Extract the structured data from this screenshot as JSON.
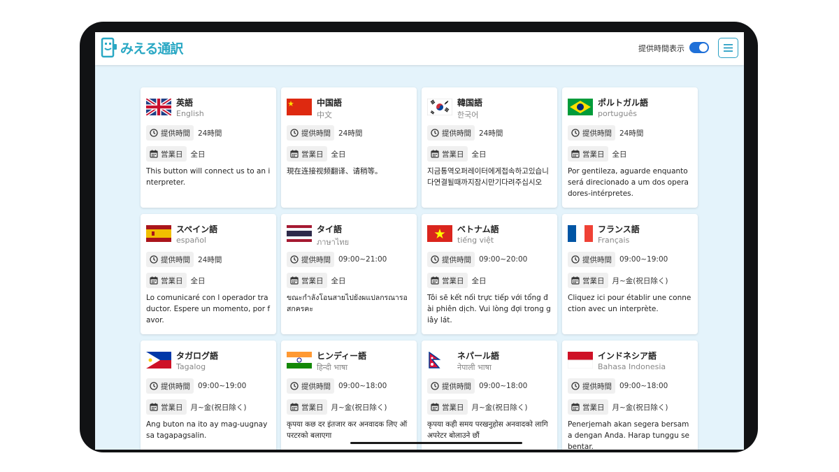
{
  "header": {
    "logo_text": "みえる通訳",
    "toggle_label": "提供時間表示",
    "toggle_on": true,
    "menu_icon": "hamburger-icon"
  },
  "labels": {
    "hours": "提供時間",
    "days": "営業日"
  },
  "cards": [
    {
      "name": "英語",
      "native": "English",
      "flag": "uk",
      "hours": "24時間",
      "days": "全日",
      "desc": "This button will connect us to an interpreter."
    },
    {
      "name": "中国語",
      "native": "中文",
      "flag": "cn",
      "hours": "24時間",
      "days": "全日",
      "desc": "現在连接视频翻译、请稍等。"
    },
    {
      "name": "韓国語",
      "native": "한국어",
      "flag": "kr",
      "hours": "24時間",
      "days": "全日",
      "desc": "지금통역오퍼레이터에게접속하고있습니다연결될때까지잠시만기다려주십시오"
    },
    {
      "name": "ポルトガル語",
      "native": "português",
      "flag": "br",
      "hours": "24時間",
      "days": "全日",
      "desc": "Por gentileza, aguarde enquanto será direcionado a um dos operadores-intérpretes."
    },
    {
      "name": "スペイン語",
      "native": "español",
      "flag": "es",
      "hours": "24時間",
      "days": "全日",
      "desc": "Lo comunicaré con l operador traductor. Espere un momento, por favor."
    },
    {
      "name": "タイ語",
      "native": "ภาษาไทย",
      "flag": "th",
      "hours": "09:00~21:00",
      "days": "全日",
      "desc": "ขณะกำลังโอนสายไปยังผแปลกรณารอสกครคะ"
    },
    {
      "name": "ベトナム語",
      "native": "tiếng việt",
      "flag": "vn",
      "hours": "09:00~20:00",
      "days": "全日",
      "desc": "Tôi sẽ kết nối trực tiếp với tổng đài phiên dịch. Vui lòng đợi trong giây lát."
    },
    {
      "name": "フランス語",
      "native": "Français",
      "flag": "fr",
      "hours": "09:00~19:00",
      "days": "月~金(祝日除く)",
      "desc": "Cliquez ici pour établir une connection avec un interprète."
    },
    {
      "name": "タガログ語",
      "native": "Tagalog",
      "flag": "ph",
      "hours": "09:00~19:00",
      "days": "月~金(祝日除く)",
      "desc": "Ang buton na ito ay mag-uugnay sa tagapagsalin."
    },
    {
      "name": "ヒンディー語",
      "native": "हिन्दी भाषा",
      "flag": "in",
      "hours": "09:00~18:00",
      "days": "月~金(祝日除く)",
      "desc": "कृपया कछ दर इंतजार कर अनवादक लिए ऑपरटरको बलाएगा"
    },
    {
      "name": "ネパール語",
      "native": "नेपाली भाषा",
      "flag": "np",
      "hours": "09:00~18:00",
      "days": "月~金(祝日除く)",
      "desc": "कृपया कही समय परखनुहोस अनवादको लागि अपरेटर बोलाउने छौं"
    },
    {
      "name": "インドネシア語",
      "native": "Bahasa Indonesia",
      "flag": "id",
      "hours": "09:00~18:00",
      "days": "月~金(祝日除く)",
      "desc": "Penerjemah akan segera bersama dengan Anda. Harap tunggu sebentar."
    }
  ],
  "colors": {
    "accent": "#1f70d8",
    "brand": "#2aa8c4",
    "background": "#e4f3fb"
  }
}
